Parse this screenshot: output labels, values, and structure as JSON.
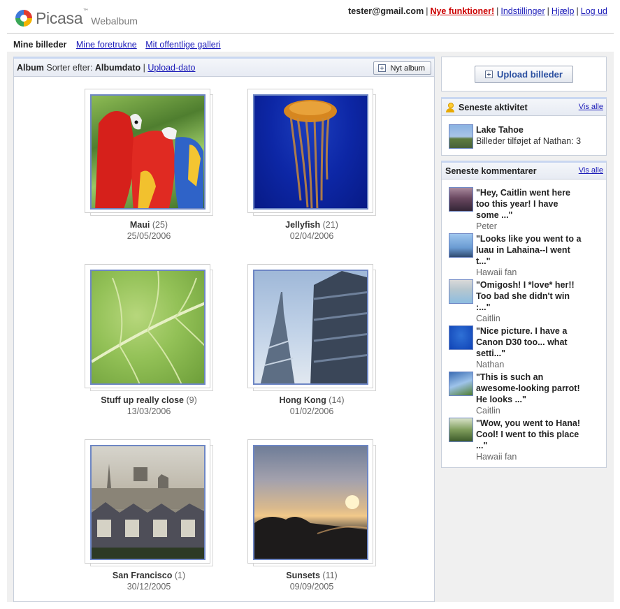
{
  "header": {
    "logo_text": "Picasa",
    "logo_tm": "™",
    "logo_sub": "Webalbum",
    "email": "tester@gmail.com",
    "new_features": "Nye funktioner!",
    "settings": "Indstillinger",
    "help": "Hjælp",
    "logout": "Log ud",
    "separator": "|"
  },
  "nav": {
    "current": "Mine billeder",
    "favorites": "Mine foretrukne",
    "public_gallery": "Mit offentlige galleri"
  },
  "album_bar": {
    "album_label": "Album",
    "sort_label": "Sorter efter:",
    "sort_current": "Albumdato",
    "separator": "|",
    "sort_alt": "Upload-dato",
    "new_album": "Nyt album"
  },
  "albums": [
    {
      "name": "Maui",
      "count": "(25)",
      "date": "25/05/2006"
    },
    {
      "name": "Jellyfish",
      "count": "(21)",
      "date": "02/04/2006"
    },
    {
      "name": "Stuff up really close",
      "count": "(9)",
      "date": "13/03/2006"
    },
    {
      "name": "Hong Kong",
      "count": "(14)",
      "date": "01/02/2006"
    },
    {
      "name": "San Francisco",
      "count": "(1)",
      "date": "30/12/2005"
    },
    {
      "name": "Sunsets",
      "count": "(11)",
      "date": "09/09/2005"
    }
  ],
  "sidebar": {
    "upload_button": "Upload billeder",
    "activity": {
      "title": "Seneste aktivitet",
      "see_all": "Vis alle",
      "item_title": "Lake Tahoe",
      "item_desc": "Billeder tilføjet af Nathan: 3"
    },
    "comments": {
      "title": "Seneste kommentarer",
      "see_all": "Vis alle",
      "items": [
        {
          "quote": "\"Hey, Caitlin went here\ntoo this year! I have\nsome ...\"",
          "author": "Peter"
        },
        {
          "quote": "\"Looks like you went to a\nluau in Lahaina--I went\nt...\"",
          "author": "Hawaii fan"
        },
        {
          "quote": "\"Omigosh! I *love* her!!\nToo bad she didn't win\n:...\"",
          "author": "Caitlin"
        },
        {
          "quote": "\"Nice picture. I have a\nCanon D30 too... what\nsetti...\"",
          "author": "Nathan"
        },
        {
          "quote": "\"This is such an\nawesome-looking parrot!\nHe looks ...\"",
          "author": "Caitlin"
        },
        {
          "quote": "\"Wow, you went to Hana!\nCool! I went to this place\n...\"",
          "author": "Hawaii fan"
        }
      ]
    }
  },
  "colors": {
    "link": "#1a1ab8",
    "new_features": "#cc0000",
    "thumb_border": "#6d86c4",
    "panel_border": "#c8cfdb",
    "panel_top": "#c9d7f1",
    "upload_text": "#2a4fa0"
  },
  "icons": [
    "picasa-logo-icon",
    "plus-icon",
    "person-icon"
  ]
}
